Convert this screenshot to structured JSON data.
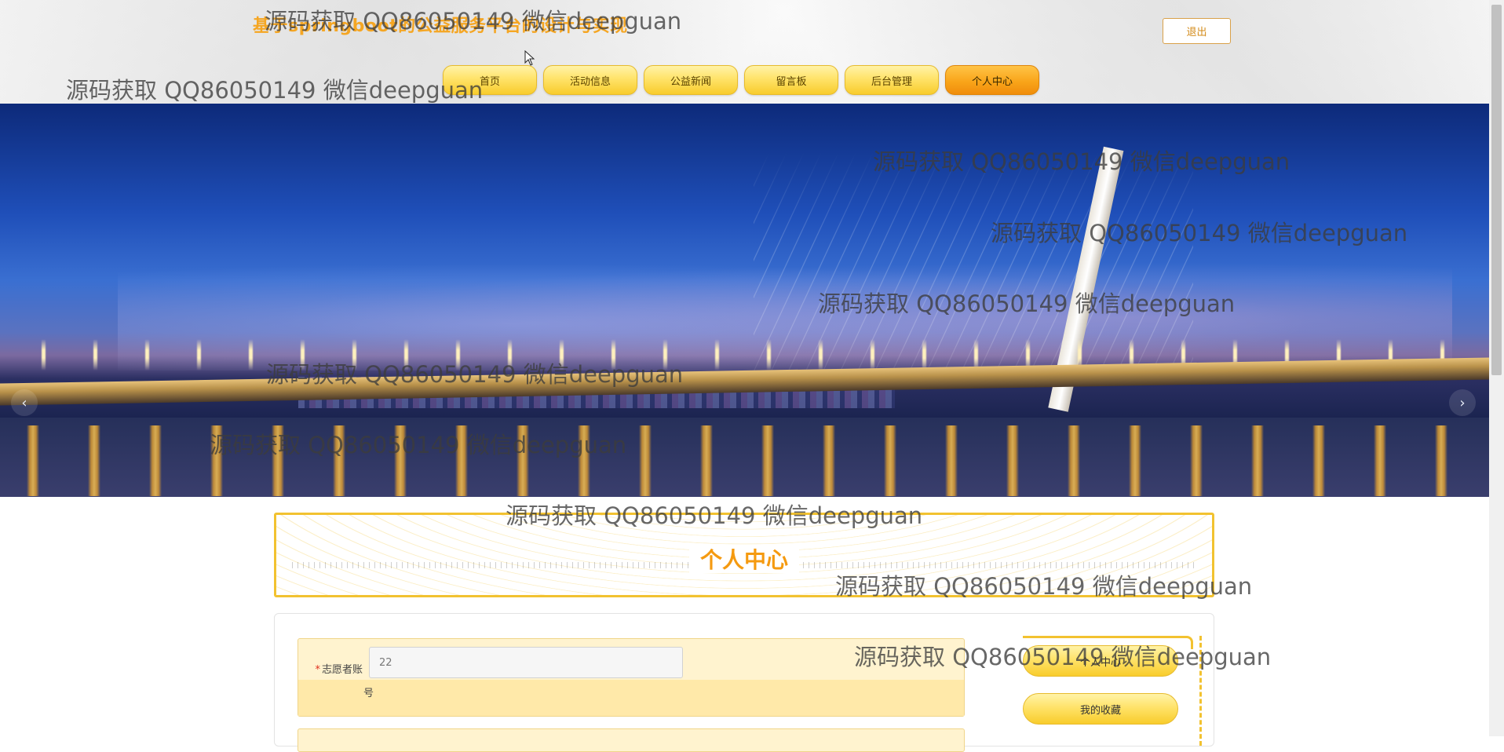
{
  "header": {
    "site_title": "基于springboot的公益服务平台的设计与实现",
    "logout_label": "退出"
  },
  "nav": {
    "items": [
      {
        "label": "首页",
        "active": false
      },
      {
        "label": "活动信息",
        "active": false
      },
      {
        "label": "公益新闻",
        "active": false
      },
      {
        "label": "留言板",
        "active": false
      },
      {
        "label": "后台管理",
        "active": false
      },
      {
        "label": "个人中心",
        "active": true
      }
    ]
  },
  "banner": {
    "prev_icon": "‹",
    "next_icon": "›",
    "slide_count": 3,
    "active_slide": 1
  },
  "section": {
    "title": "个人中心"
  },
  "form": {
    "account_label": "志愿者账",
    "account_label_wrap": "号",
    "required_mark": "*",
    "account_value": "22"
  },
  "side_menu": {
    "items": [
      "个人中心",
      "我的收藏"
    ]
  },
  "watermark": {
    "text": "源码获取 QQ86050149 微信deepguan"
  },
  "colors": {
    "accent": "#f5a623",
    "nav_yellow": "#ffe36a",
    "nav_active": "#f9a51a",
    "section_border": "#f2c230",
    "title_orange": "#f59a10"
  }
}
